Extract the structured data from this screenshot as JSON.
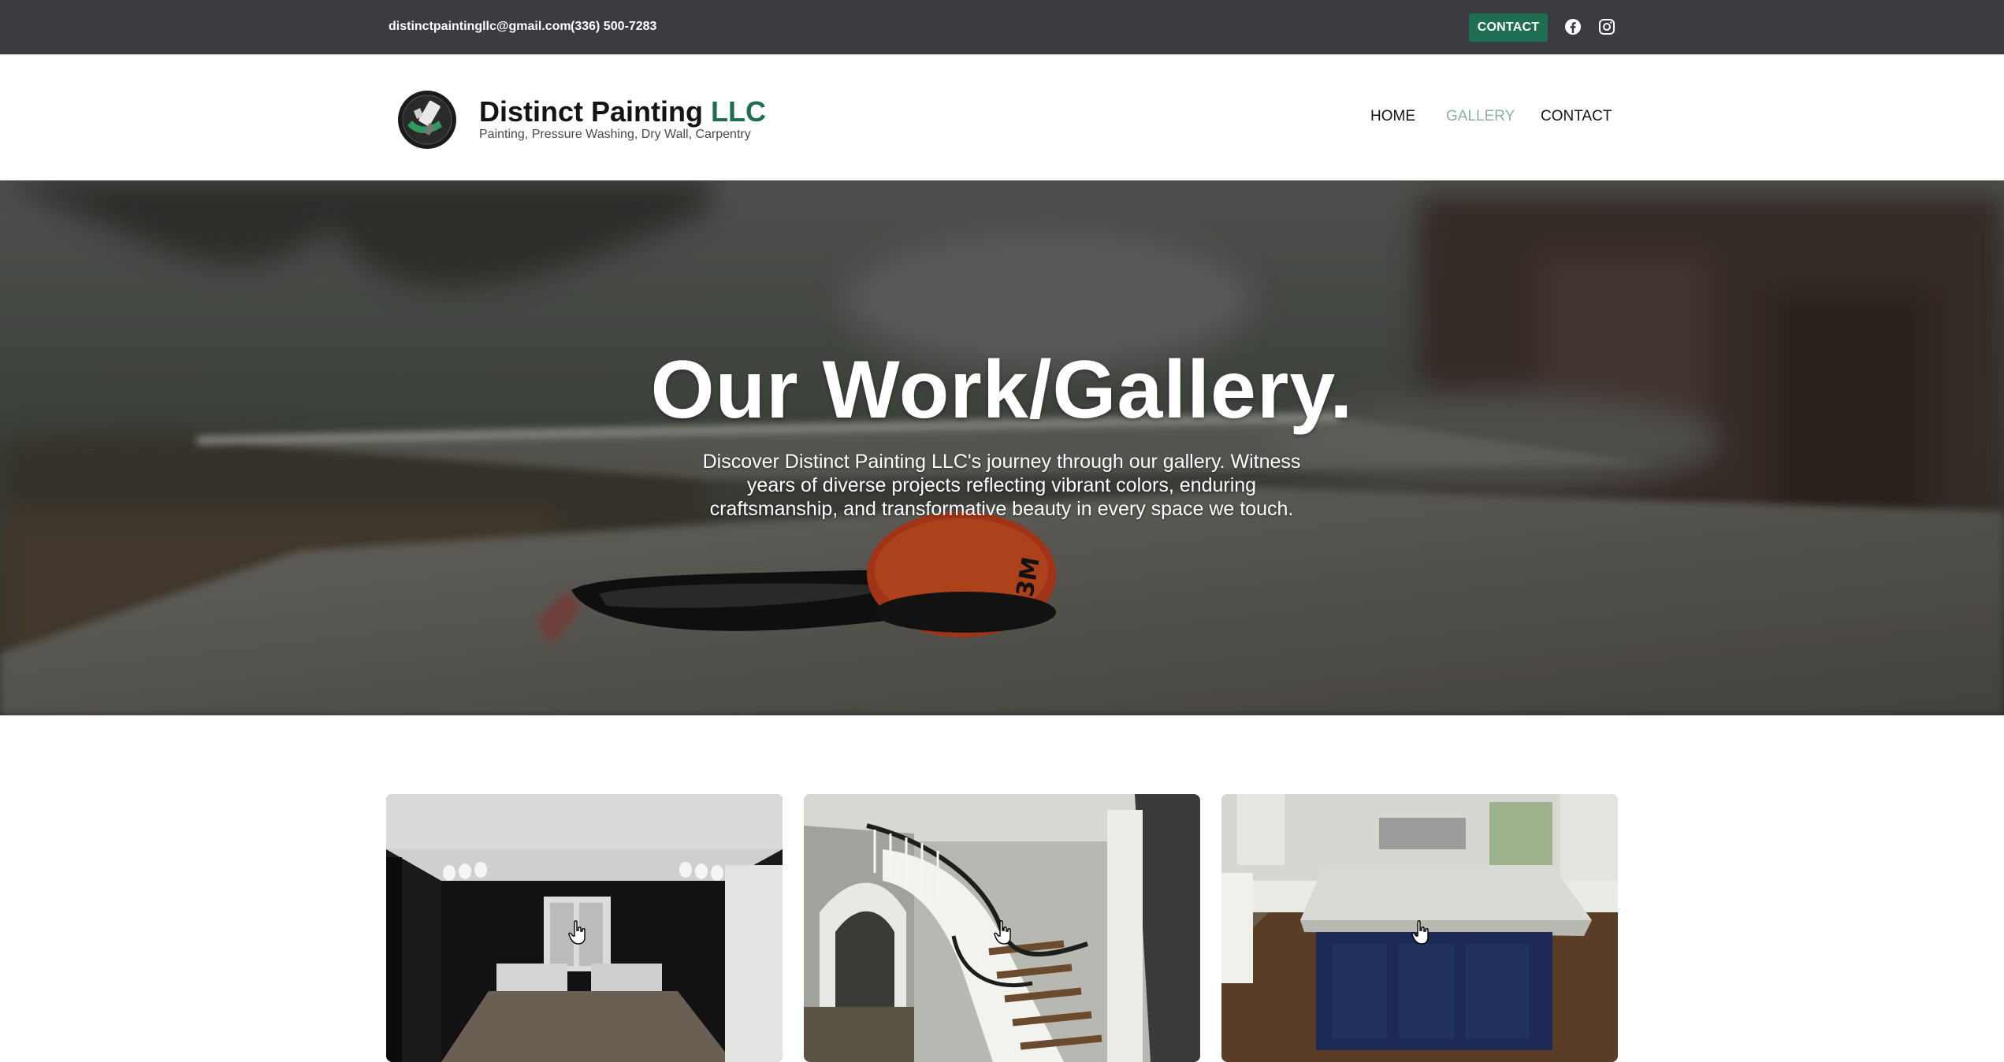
{
  "topbar": {
    "email": "distinctpaintingllc@gmail.com",
    "phone": "(336) 500-7283",
    "contact_label": "CONTACT",
    "social_icons": [
      "facebook-icon",
      "instagram-icon"
    ]
  },
  "header": {
    "brand_main": "Distinct Painting",
    "brand_accent": "LLC",
    "tagline": "Painting, Pressure Washing, Dry Wall, Carpentry",
    "nav": {
      "home": "HOME",
      "gallery": "GALLERY",
      "contact": "CONTACT",
      "active": "GALLERY"
    }
  },
  "hero": {
    "title": "Our Work/Gallery.",
    "subtitle": "Discover Distinct Painting LLC's journey through our gallery. Witness years of diverse projects reflecting vibrant colors, enduring craftsmanship, and transformative beauty in every space we touch."
  },
  "gallery": {
    "items": [
      {
        "name": "black-painted-room-photo"
      },
      {
        "name": "staircase-photo"
      },
      {
        "name": "kitchen-island-photo"
      }
    ]
  },
  "colors": {
    "topbar_bg": "#3b3c42",
    "accent_green": "#1f6e53",
    "nav_active": "#8faf9f"
  }
}
